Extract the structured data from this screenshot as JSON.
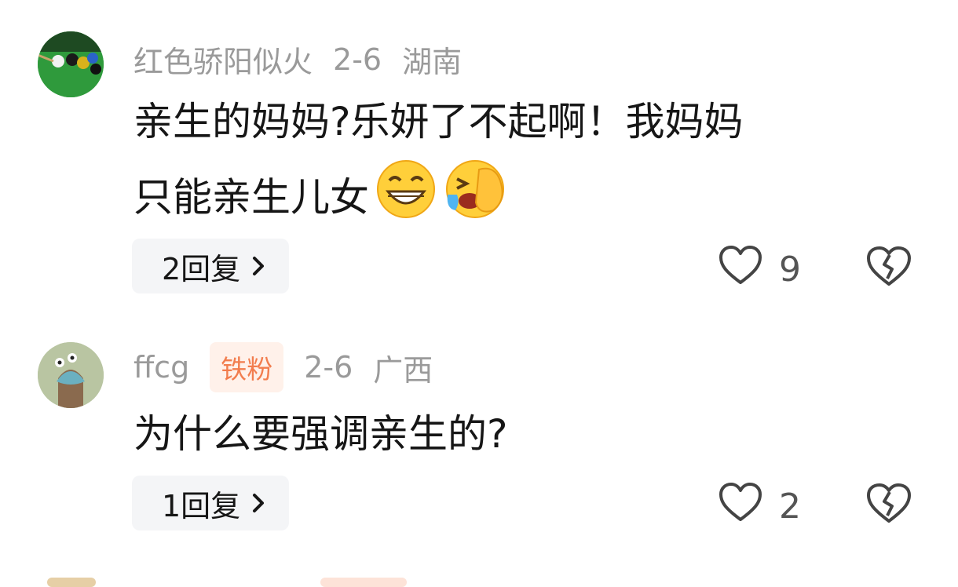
{
  "comments": [
    {
      "username": "红色骄阳似火",
      "date": "2-6",
      "location": "湖南",
      "text_line1": "亲生的妈妈?乐妍了不起啊！我妈妈",
      "text_line2": "只能亲生儿女",
      "emojis": [
        "grinning-face-emoji",
        "laughing-tears-emoji"
      ],
      "replies_label": "2回复",
      "likes": "9",
      "avatar_icon": "billiards-avatar"
    },
    {
      "username": "ffcg",
      "badge": "铁粉",
      "date": "2-6",
      "location": "广西",
      "text_line1": "为什么要强调亲生的?",
      "replies_label": "1回复",
      "likes": "2",
      "avatar_icon": "cartoon-avatar"
    }
  ],
  "colors": {
    "meta_gray": "#9a9a9a",
    "badge_bg": "#fff1ea",
    "badge_text": "#f27d4e",
    "reply_bg": "#f4f5f7"
  }
}
